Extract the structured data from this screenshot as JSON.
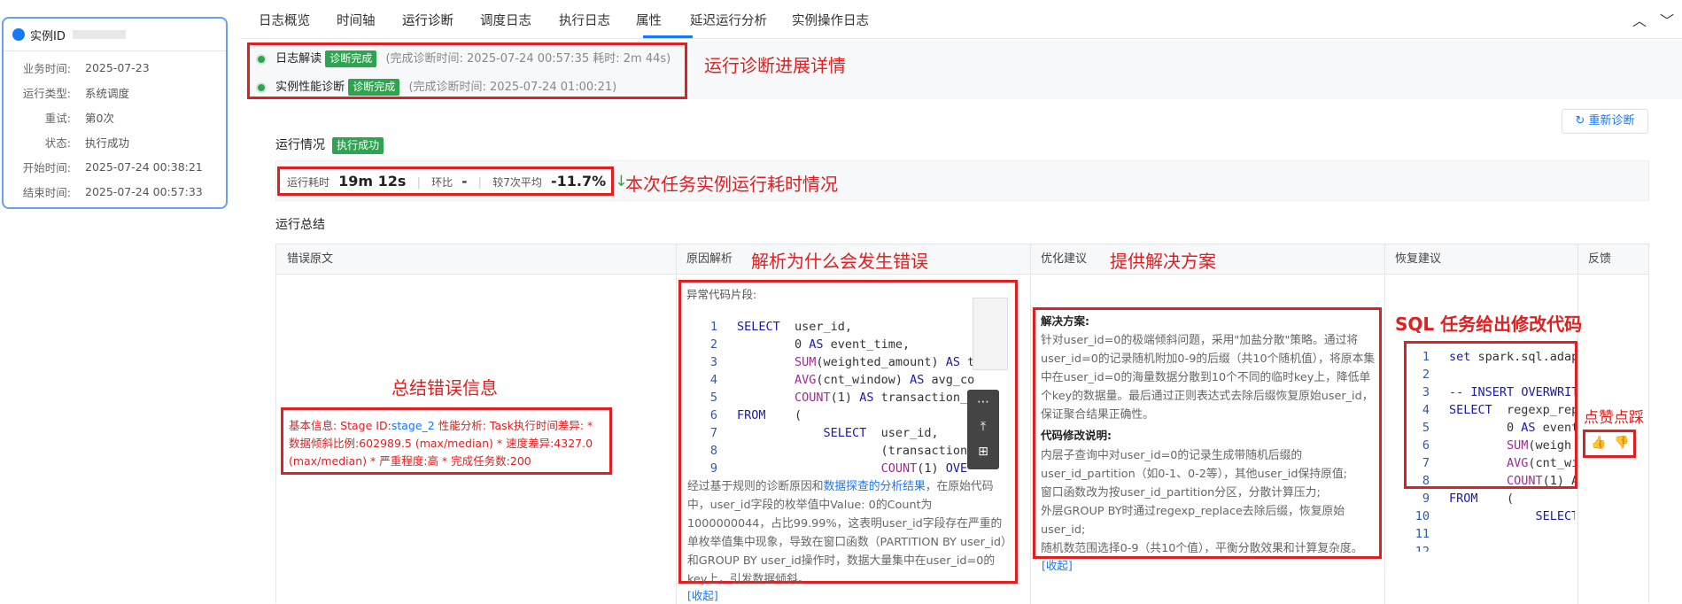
{
  "sidebar": {
    "title": "实例ID",
    "rows": [
      {
        "label": "业务时间:",
        "value": "2025-07-23"
      },
      {
        "label": "运行类型:",
        "value": "系统调度"
      },
      {
        "label": "重试:",
        "value": "第0次"
      },
      {
        "label": "状态:",
        "value": "执行成功"
      },
      {
        "label": "开始时间:",
        "value": "2025-07-24 00:38:21"
      },
      {
        "label": "结束时间:",
        "value": "2025-07-24 00:57:33"
      }
    ]
  },
  "tabs": [
    "日志概览",
    "时间轴",
    "运行诊断",
    "调度日志",
    "执行日志",
    "属性",
    "延迟运行分析",
    "实例操作日志"
  ],
  "active_tab": "运行诊断",
  "diagnosis": {
    "items": [
      {
        "name": "日志解读",
        "status": "诊断完成",
        "detail": "(完成诊断时间: 2025-07-24 00:57:35 耗时: 2m 44s)"
      },
      {
        "name": "实例性能诊断",
        "status": "诊断完成",
        "detail": "(完成诊断时间: 2025-07-24 01:00:21)"
      }
    ],
    "rediagnose": "重新诊断"
  },
  "run": {
    "title": "运行情况",
    "status": "执行成功",
    "duration_label": "运行耗时",
    "duration_value": "19m 12s",
    "ratio_label": "环比",
    "ratio_value": "-",
    "avg_label": "较7次平均",
    "avg_value": "-11.7%",
    "avg_arrow": "↓"
  },
  "summary": {
    "title": "运行总结",
    "headers": [
      "错误原文",
      "原因解析",
      "优化建议",
      "恢复建议",
      "反馈"
    ],
    "error_text_prefix": "基本信息: Stage ID:",
    "error_stage": "stage_2",
    "error_text": " 性能分析: Task执行时间差异: * 数据倾斜比例:602989.5 (max/median) * 速度差异:4327.0 (max/median) * 严重程度:高 * 完成任务数:200",
    "cause_label": "异常代码片段:",
    "cause_code": [
      {
        "n": "1",
        "t": "SELECT  user_id,"
      },
      {
        "n": "2",
        "t": "        0 AS event_time,"
      },
      {
        "n": "3",
        "t": "        SUM(weighted_amount) AS t"
      },
      {
        "n": "4",
        "t": "        AVG(cnt_window) AS avg_co"
      },
      {
        "n": "5",
        "t": "        COUNT(1) AS transaction_"
      },
      {
        "n": "6",
        "t": "FROM    ("
      },
      {
        "n": "7",
        "t": "            SELECT  user_id,"
      },
      {
        "n": "8",
        "t": "                    (transaction"
      },
      {
        "n": "9",
        "t": "                    COUNT(1) OVE"
      }
    ],
    "cause_text_1": "经过基于规则的诊断原因和",
    "cause_link": "数据探查的分析结果",
    "cause_text_2": "，在原始代码中，user_id字段的枚举值中Value: 0的Count为1000000044，占比99.99%，这表明user_id字段存在严重的单枚举值集中现象，导致在窗口函数（PARTITION BY user_id）和GROUP BY user_id操作时，数据大量集中在user_id=0的key上，引发数据倾斜。",
    "collapse": "[收起]",
    "opt_title": "解决方案:",
    "opt_text": "针对user_id=0的极端倾斜问题，采用\"加盐分散\"策略。通过将user_id=0的记录随机附加0-9的后缀（共10个随机值），将原本集中在user_id=0的海量数据分散到10个不同的临时key上，降低单个key的数据量。最后通过正则表达式去除后缀恢复原始user_id，保证聚合结果正确性。",
    "opt_title2": "代码修改说明:",
    "opt_text2_1": "内层子查询中对user_id=0的记录生成带随机后缀的user_id_partition（如0-1、0-2等），其他user_id保持原值;",
    "opt_text2_2": "窗口函数改为按user_id_partition分区，分散计算压力;",
    "opt_text2_3": "外层GROUP BY时通过regexp_replace去除后缀，恢复原始user_id;",
    "opt_text2_4": "随机数范围选择0-9（共10个值），平衡分散效果和计算复杂度。",
    "fix_code": [
      {
        "n": "1",
        "t": "set spark.sql.adap"
      },
      {
        "n": "2",
        "t": ""
      },
      {
        "n": "3",
        "t": "-- INSERT OVERWRIT"
      },
      {
        "n": "4",
        "t": "SELECT  regexp_rep"
      },
      {
        "n": "5",
        "t": "        0 AS event"
      },
      {
        "n": "6",
        "t": "        SUM(weigh"
      },
      {
        "n": "7",
        "t": "        AVG(cnt_wi"
      },
      {
        "n": "8",
        "t": "        COUNT(1) A"
      },
      {
        "n": "9",
        "t": "FROM    ("
      },
      {
        "n": "10",
        "t": "            SELECT"
      },
      {
        "n": "11",
        "t": ""
      },
      {
        "n": "12",
        "t": ""
      }
    ]
  },
  "annotations": {
    "progress": "运行诊断进展详情",
    "duration": "本次任务实例运行耗时情况",
    "cause": "解析为什么会发生错误",
    "solution": "提供解决方案",
    "error": "总结错误信息",
    "sql": "SQL 任务给出修改代码",
    "like": "点赞点踩"
  }
}
